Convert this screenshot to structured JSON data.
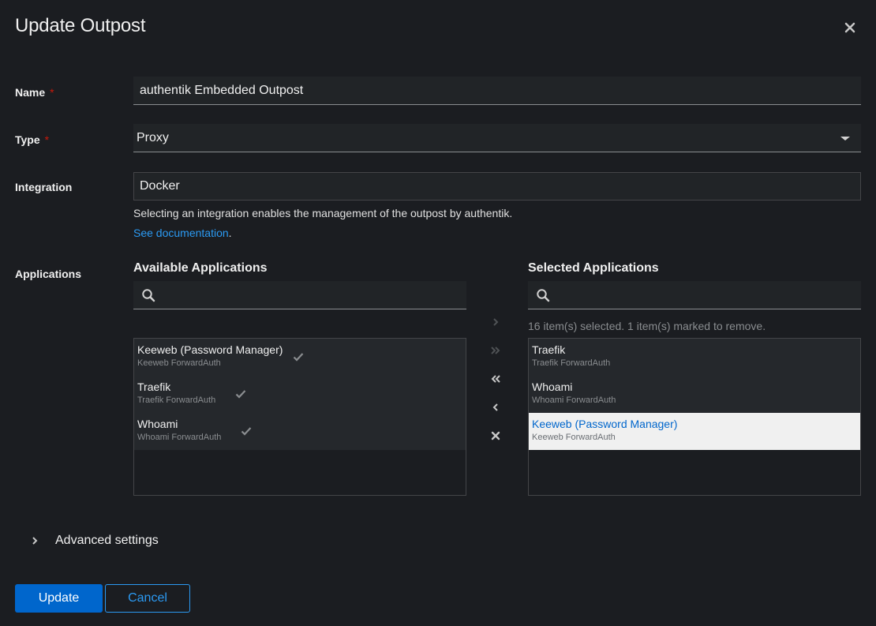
{
  "modal": {
    "title": "Update Outpost"
  },
  "form": {
    "name": {
      "label": "Name",
      "required_mark": "*",
      "value": "authentik Embedded Outpost"
    },
    "type": {
      "label": "Type",
      "required_mark": "*",
      "value": "Proxy"
    },
    "integration": {
      "label": "Integration",
      "value": "Docker",
      "helper": "Selecting an integration enables the management of the outpost by authentik.",
      "doc_link": "See documentation",
      "doc_link_suffix": "."
    },
    "applications": {
      "label": "Applications",
      "available": {
        "title": "Available Applications",
        "search_placeholder": "",
        "items": [
          {
            "name": "Keeweb (Password Manager)",
            "provider": "Keeweb ForwardAuth",
            "state": "check-icon"
          },
          {
            "name": "Traefik",
            "provider": "Traefik ForwardAuth",
            "state": "check-icon"
          },
          {
            "name": "Whoami",
            "provider": "Whoami ForwardAuth",
            "state": "check-icon"
          }
        ]
      },
      "selected": {
        "title": "Selected Applications",
        "search_placeholder": "",
        "status": "16 item(s) selected. 1 item(s) marked to remove.",
        "items": [
          {
            "name": "Traefik",
            "provider": "Traefik ForwardAuth"
          },
          {
            "name": "Whoami",
            "provider": "Whoami ForwardAuth"
          },
          {
            "name": "Keeweb (Password Manager)",
            "provider": "Keeweb ForwardAuth",
            "highlighted": true
          }
        ]
      },
      "controls": [
        "add-selected-icon",
        "add-all-icon",
        "remove-all-icon",
        "remove-selected-icon",
        "clear-icon"
      ]
    },
    "advanced": {
      "label": "Advanced settings"
    }
  },
  "footer": {
    "primary_label": "Update",
    "secondary_label": "Cancel"
  },
  "colors": {
    "background": "#1b1d21",
    "input_bg": "#212427",
    "accent": "#0066cc",
    "link": "#2b9af3",
    "required": "#c9190b",
    "highlight_bg": "#f0f0f0"
  }
}
